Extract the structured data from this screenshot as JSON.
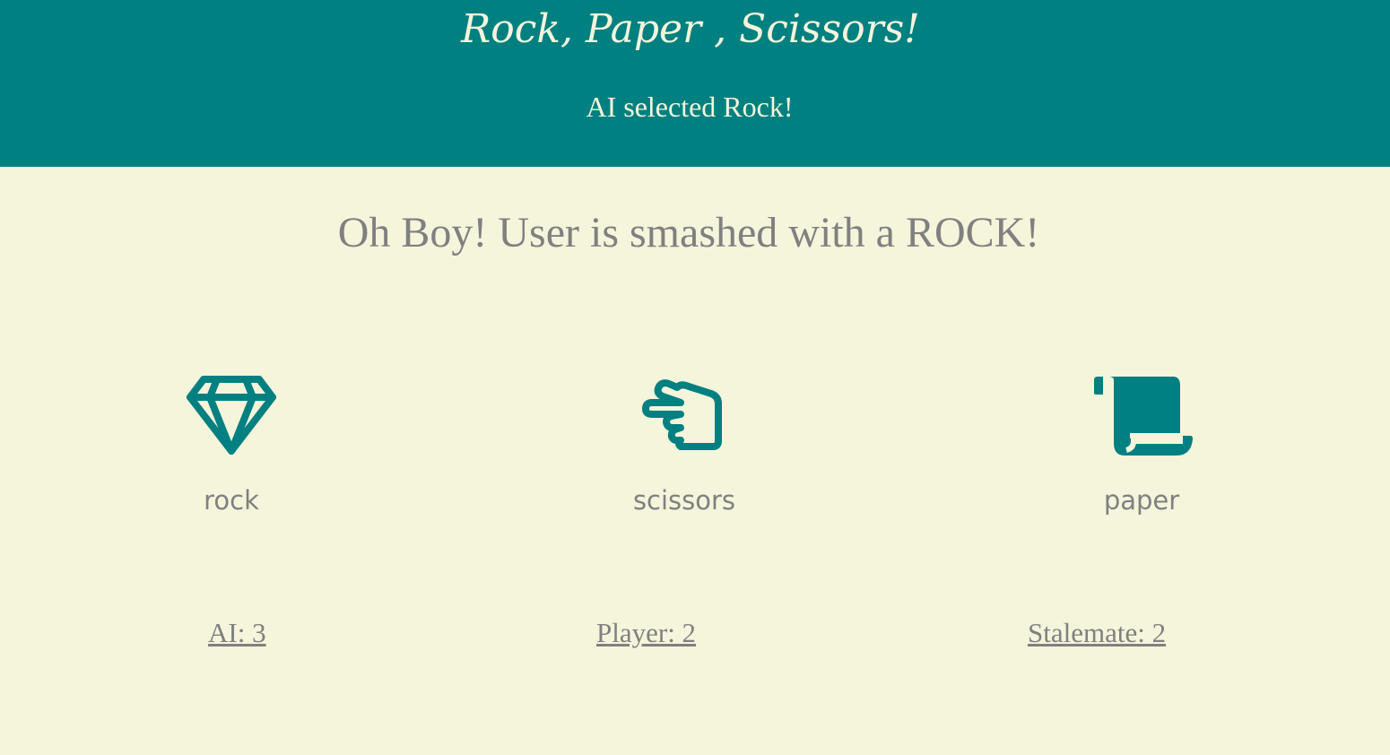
{
  "header": {
    "title": "Rock, Paper , Scissors!",
    "ai_selection": "AI selected Rock!"
  },
  "result": {
    "message": "Oh Boy! User is smashed with a ROCK!"
  },
  "choices": [
    {
      "label": "rock",
      "icon": "gem-icon"
    },
    {
      "label": "scissors",
      "icon": "hand-scissors-icon"
    },
    {
      "label": "paper",
      "icon": "scroll-icon"
    }
  ],
  "scores": {
    "ai": "AI: 3",
    "player": "Player: 2",
    "stalemate": "Stalemate: 2"
  },
  "colors": {
    "header_bg": "#008080",
    "page_bg": "#f5f5dc",
    "icon": "#008080",
    "text": "#808080",
    "header_text": "#f5f5dc"
  }
}
